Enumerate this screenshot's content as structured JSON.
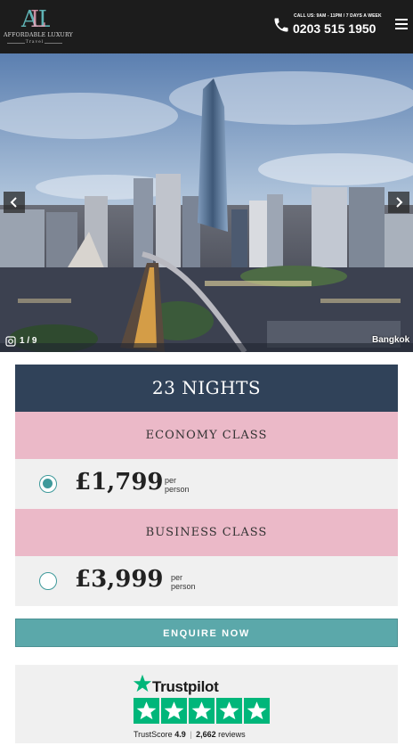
{
  "header": {
    "logo_mark": "AL",
    "logo_name": "AFFORDABLE LUXURY",
    "logo_sub": "Travel",
    "call_hours": "CALL US: 9AM - 11PM / 7 DAYS A WEEK",
    "phone": "0203 515 1950"
  },
  "gallery": {
    "counter": "1 / 9",
    "location": "Bangkok"
  },
  "offer": {
    "nights": "23 NIGHTS",
    "options": [
      {
        "class_label": "ECONOMY CLASS",
        "price": "£1,799",
        "per": "per",
        "person": "person",
        "selected": true
      },
      {
        "class_label": "BUSINESS CLASS",
        "price": "£3,999",
        "per": "per",
        "person": "person",
        "selected": false
      }
    ],
    "enquire_label": "ENQUIRE NOW"
  },
  "trustpilot": {
    "brand": "Trustpilot",
    "score_label": "TrustScore",
    "score": "4.9",
    "separator": "|",
    "reviews_count": "2,662",
    "reviews_label": "reviews",
    "stars": 5
  },
  "colors": {
    "header_bg": "#1c1c1c",
    "nights_bg": "#304259",
    "class_bg": "#ebb9c8",
    "price_bg": "#f0f0f0",
    "accent": "#5ba8aa",
    "trustpilot_green": "#00b67a"
  },
  "icons": [
    "phone-icon",
    "menu-icon",
    "chevron-left-icon",
    "chevron-right-icon",
    "gallery-icon",
    "star-icon"
  ]
}
